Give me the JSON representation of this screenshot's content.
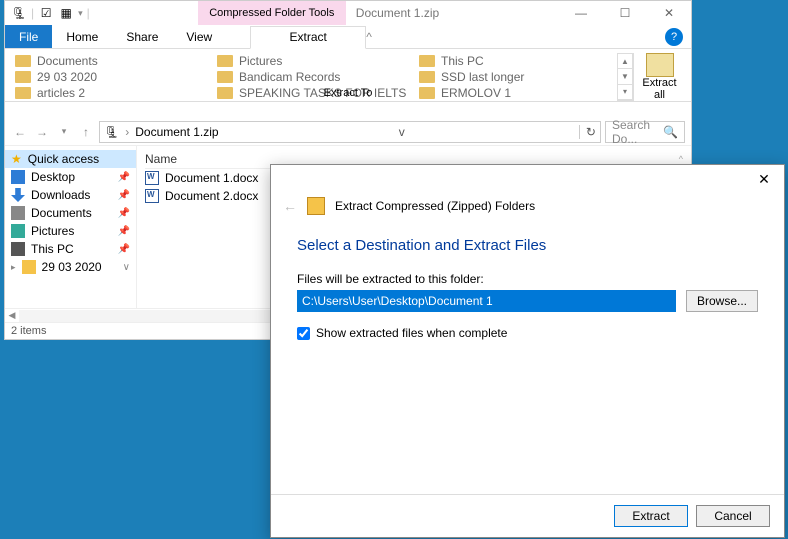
{
  "titlebar": {
    "contextual_tab": "Compressed Folder Tools",
    "document_title": "Document 1.zip"
  },
  "tabs": {
    "file": "File",
    "home": "Home",
    "share": "Share",
    "view": "View",
    "extract": "Extract"
  },
  "ribbon": {
    "col1": [
      "Documents",
      "29 03 2020",
      "articles 2"
    ],
    "col2": [
      "Pictures",
      "Bandicam Records",
      "SPEAKING TASKS FOR IELTS"
    ],
    "col3": [
      "This PC",
      "SSD last longer",
      "ERMOLOV 1"
    ],
    "extract_all": "Extract\nall",
    "group_label": "Extract To"
  },
  "address": {
    "path": "Document 1.zip",
    "search_placeholder": "Search Do..."
  },
  "nav": {
    "quick_access": "Quick access",
    "items": [
      {
        "label": "Desktop",
        "pinned": true,
        "icon": "ni-desktop"
      },
      {
        "label": "Downloads",
        "pinned": true,
        "icon": "ni-downloads"
      },
      {
        "label": "Documents",
        "pinned": true,
        "icon": "ni-documents"
      },
      {
        "label": "Pictures",
        "pinned": true,
        "icon": "ni-pictures"
      },
      {
        "label": "This PC",
        "pinned": true,
        "icon": "ni-thispc"
      },
      {
        "label": "29 03 2020",
        "pinned": false,
        "icon": "ni-folder"
      }
    ]
  },
  "content": {
    "header_name": "Name",
    "files": [
      "Document 1.docx",
      "Document 2.docx"
    ]
  },
  "status": {
    "items": "2 items"
  },
  "dialog": {
    "title_header": "Extract Compressed (Zipped) Folders",
    "heading": "Select a Destination and Extract Files",
    "label": "Files will be extracted to this folder:",
    "path": "C:\\Users\\User\\Desktop\\Document 1",
    "browse": "Browse...",
    "checkbox": "Show extracted files when complete",
    "extract": "Extract",
    "cancel": "Cancel"
  }
}
